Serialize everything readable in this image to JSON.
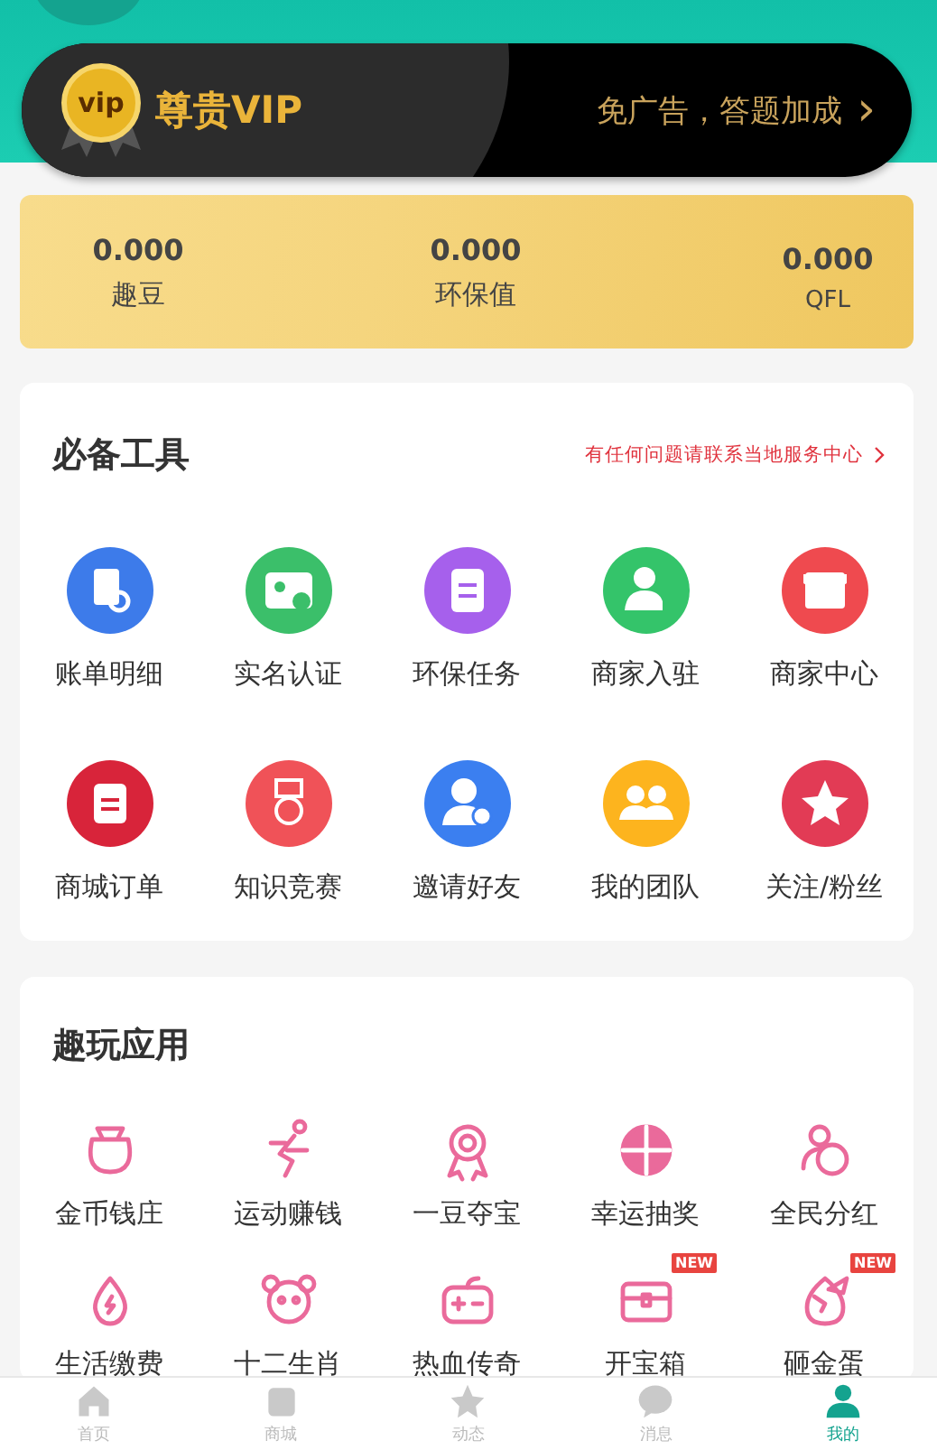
{
  "vip": {
    "title": "尊贵VIP",
    "badge": "vip",
    "perks": "免广告，答题加成",
    "chevron": "›"
  },
  "stats": [
    {
      "value": "0.000",
      "label": "趣豆"
    },
    {
      "value": "0.000",
      "label": "环保值"
    },
    {
      "value": "0.000",
      "label": "QFL"
    }
  ],
  "tools": {
    "title": "必备工具",
    "link": "有任何问题请联系当地服务中心",
    "items": [
      {
        "label": "账单明细"
      },
      {
        "label": "实名认证"
      },
      {
        "label": "环保任务"
      },
      {
        "label": "商家入驻"
      },
      {
        "label": "商家中心"
      },
      {
        "label": "商城订单"
      },
      {
        "label": "知识竞赛"
      },
      {
        "label": "邀请好友"
      },
      {
        "label": "我的团队"
      },
      {
        "label": "关注/粉丝"
      }
    ]
  },
  "apps": {
    "title": "趣玩应用",
    "items": [
      {
        "label": "金币钱庄"
      },
      {
        "label": "运动赚钱"
      },
      {
        "label": "一豆夺宝"
      },
      {
        "label": "幸运抽奖"
      },
      {
        "label": "全民分红"
      },
      {
        "label": "生活缴费"
      },
      {
        "label": "十二生肖"
      },
      {
        "label": "热血传奇"
      },
      {
        "label": "开宝箱",
        "badge": "NEW"
      },
      {
        "label": "砸金蛋",
        "badge": "NEW"
      }
    ]
  },
  "tab_bar": [
    {
      "label": "首页",
      "selected": false
    },
    {
      "label": "商城",
      "selected": false
    },
    {
      "label": "动态",
      "selected": false
    },
    {
      "label": "消息",
      "selected": false
    },
    {
      "label": "我的",
      "selected": true
    }
  ]
}
